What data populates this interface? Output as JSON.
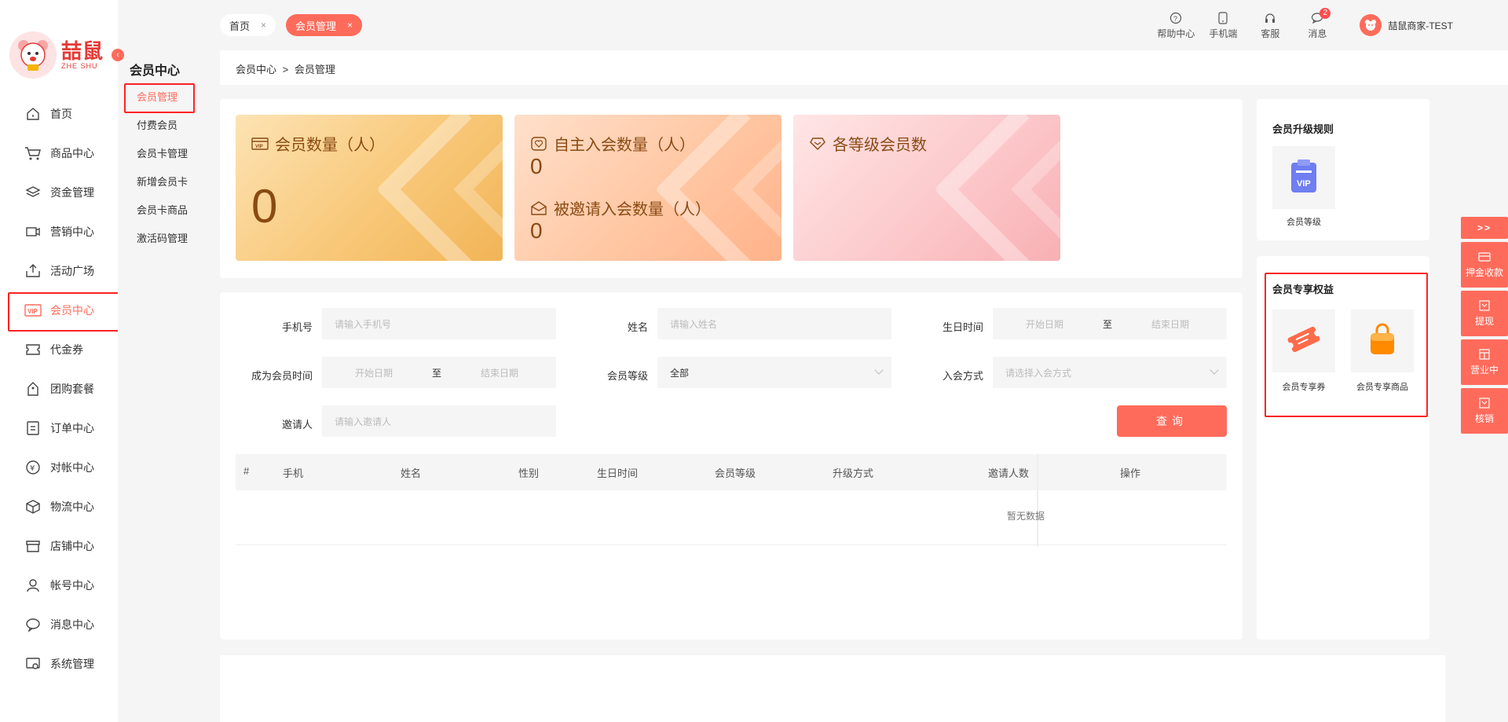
{
  "brand": {
    "cn": "喆鼠",
    "en": "ZHE SHU"
  },
  "sidebar": {
    "items": [
      {
        "label": "首页",
        "icon": "home-icon"
      },
      {
        "label": "商品中心",
        "icon": "cart-icon"
      },
      {
        "label": "资金管理",
        "icon": "layers-icon"
      },
      {
        "label": "营销中心",
        "icon": "marketing-icon"
      },
      {
        "label": "活动广场",
        "icon": "activity-icon"
      },
      {
        "label": "会员中心",
        "icon": "vip-icon"
      },
      {
        "label": "代金券",
        "icon": "coupon-icon"
      },
      {
        "label": "团购套餐",
        "icon": "group-buy-icon"
      },
      {
        "label": "订单中心",
        "icon": "order-icon"
      },
      {
        "label": "对帐中心",
        "icon": "reconcile-icon"
      },
      {
        "label": "物流中心",
        "icon": "logistics-icon"
      },
      {
        "label": "店铺中心",
        "icon": "store-icon"
      },
      {
        "label": "帐号中心",
        "icon": "account-icon"
      },
      {
        "label": "消息中心",
        "icon": "message-icon"
      },
      {
        "label": "系统管理",
        "icon": "system-icon"
      }
    ]
  },
  "subnav": {
    "title": "会员中心",
    "items": [
      "会员管理",
      "付费会员",
      "会员卡管理",
      "新增会员卡",
      "会员卡商品",
      "激活码管理"
    ]
  },
  "tabs": [
    {
      "label": "首页",
      "close": "×"
    },
    {
      "label": "会员管理",
      "close": "×"
    }
  ],
  "top_actions": [
    {
      "label": "帮助中心",
      "icon": "help-icon"
    },
    {
      "label": "手机端",
      "icon": "mobile-icon"
    },
    {
      "label": "客服",
      "icon": "headset-icon"
    },
    {
      "label": "消息",
      "icon": "chat-icon",
      "badge": "2"
    }
  ],
  "user": {
    "name": "喆鼠商家-TEST"
  },
  "breadcrumb": {
    "parent": "会员中心",
    "sep": ">",
    "current": "会员管理"
  },
  "stats": {
    "members": {
      "label": "会员数量（人）",
      "value": "0"
    },
    "self_join": {
      "label": "自主入会数量（人）",
      "value": "0"
    },
    "invited": {
      "label": "被邀请入会数量（人）",
      "value": "0"
    },
    "levels": {
      "label": "各等级会员数"
    }
  },
  "filters": {
    "phone": {
      "label": "手机号",
      "placeholder": "请输入手机号"
    },
    "name": {
      "label": "姓名",
      "placeholder": "请输入姓名"
    },
    "birthday": {
      "label": "生日时间",
      "start": "开始日期",
      "sep": "至",
      "end": "结束日期"
    },
    "join_time": {
      "label": "成为会员时间",
      "start": "开始日期",
      "sep": "至",
      "end": "结束日期"
    },
    "level": {
      "label": "会员等级",
      "value": "全部"
    },
    "method": {
      "label": "入会方式",
      "placeholder": "请选择入会方式"
    },
    "inviter": {
      "label": "邀请人",
      "placeholder": "请输入邀请人"
    },
    "query_label": "查询"
  },
  "table": {
    "columns": [
      "#",
      "手机",
      "姓名",
      "性别",
      "生日时间",
      "会员等级",
      "升级方式",
      "邀请人数",
      "操作"
    ],
    "empty_text": "暂无数据"
  },
  "upgrade": {
    "title": "会员升级规则",
    "item": "会员等级"
  },
  "rights": {
    "title": "会员专享权益",
    "items": [
      "会员专享券",
      "会员专享商品"
    ]
  },
  "floaters": {
    "expand": ">>",
    "items": [
      "押金收款",
      "提现",
      "营业中",
      "核销"
    ]
  },
  "colors": {
    "accent": "#ff6b5b",
    "highlight": "#ff2222"
  }
}
